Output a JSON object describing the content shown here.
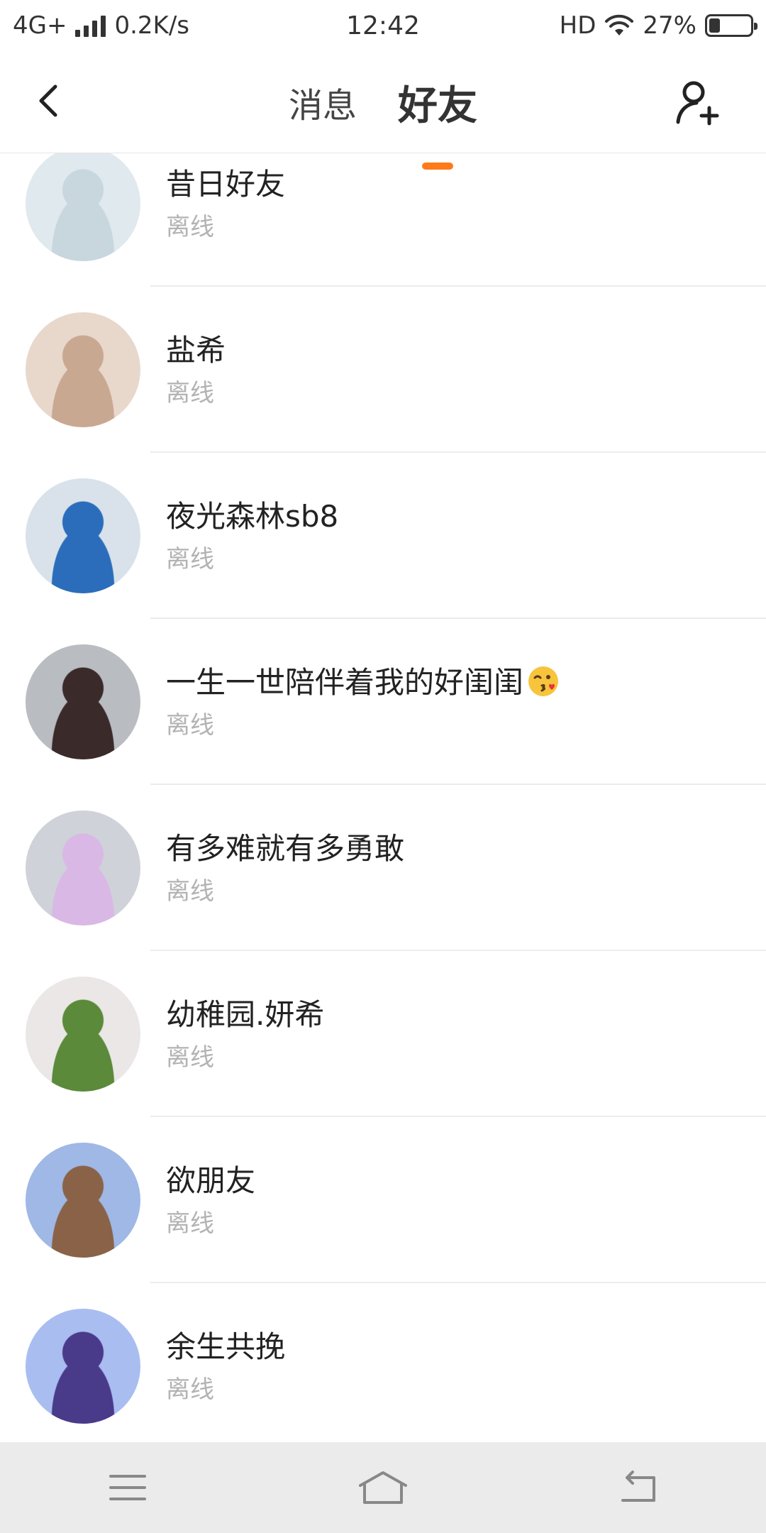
{
  "status_bar": {
    "network": "4G+",
    "speed": "0.2K/s",
    "time": "12:42",
    "hd": "HD",
    "battery_percent": "27%",
    "battery_level": 0.27
  },
  "header": {
    "tabs": [
      {
        "label": "消息",
        "active": false
      },
      {
        "label": "好友",
        "active": true
      }
    ],
    "accent_color": "#ff7a1a"
  },
  "friends": [
    {
      "name": "昔日好友",
      "status": "离线",
      "avatar_colors": [
        "#dfe9ee",
        "#c8d6de"
      ]
    },
    {
      "name": "盐希",
      "status": "离线",
      "avatar_colors": [
        "#e8d8cc",
        "#c9a892"
      ]
    },
    {
      "name": "夜光森林sb8",
      "status": "离线",
      "avatar_colors": [
        "#d9e2ea",
        "#2b6dbb"
      ]
    },
    {
      "name": "一生一世陪伴着我的好闺闺",
      "status": "离线",
      "avatar_colors": [
        "#b9bcc0",
        "#3a2a2a"
      ],
      "emoji": "kiss-face-icon"
    },
    {
      "name": "有多难就有多勇敢",
      "status": "离线",
      "avatar_colors": [
        "#cfd2d8",
        "#d9b8e6"
      ]
    },
    {
      "name": "幼稚园.妍希",
      "status": "离线",
      "avatar_colors": [
        "#ebe7e6",
        "#5a8a3a"
      ]
    },
    {
      "name": "欲朋友",
      "status": "离线",
      "avatar_colors": [
        "#9fb8e6",
        "#8a6248"
      ]
    },
    {
      "name": "余生共挽",
      "status": "离线",
      "avatar_colors": [
        "#a9bdf0",
        "#4a3a8a"
      ]
    }
  ],
  "system_nav": {
    "icons": [
      "menu-icon",
      "home-icon",
      "back-return-icon"
    ]
  }
}
